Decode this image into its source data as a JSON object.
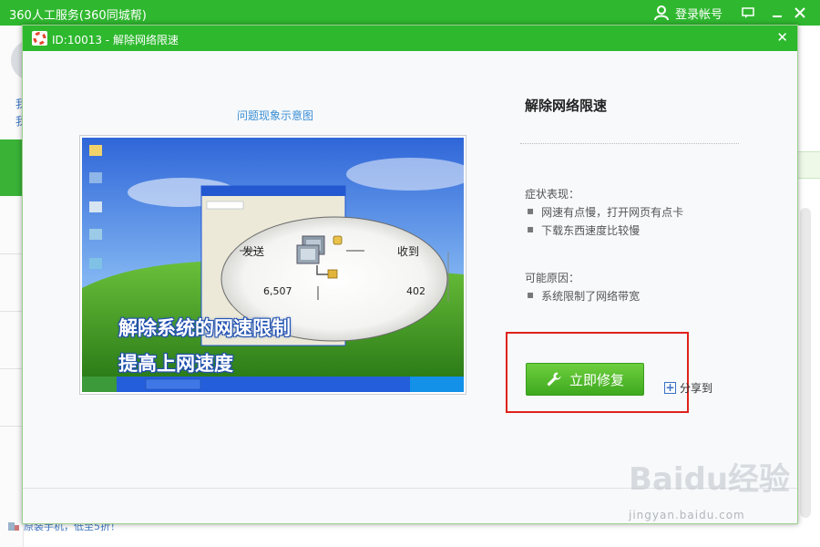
{
  "app": {
    "title": "360人工服务(360同城帮)",
    "login_label": "登录帐号",
    "side_text_1": "我",
    "side_text_2": "我",
    "bottom_link": "原装手机，低至5折！"
  },
  "dialog": {
    "title": "ID:10013 - 解除网络限速",
    "close_label": "✕"
  },
  "illustration": {
    "caption": "问题现象示意图",
    "overlay_line1": "解除系统的网速限制",
    "overlay_line2": "提高上网速度",
    "sent_label": "发送",
    "received_label": "收到",
    "sent_value": "6,507",
    "received_value": "402"
  },
  "issue": {
    "title": "解除网络限速",
    "symptoms_heading": "症状表现：",
    "symptoms": [
      "网速有点慢，打开网页有点卡",
      "下载东西速度比较慢"
    ],
    "causes_heading": "可能原因：",
    "causes": [
      "系统限制了网络带宽"
    ]
  },
  "actions": {
    "fix_label": "立即修复",
    "share_label": "分享到"
  },
  "watermark": {
    "main": "Baidu经验",
    "sub": "jingyan.baidu.com"
  },
  "colors": {
    "brand_green": "#2db82d",
    "highlight_red": "#e0221b",
    "link_blue": "#3c8fd5"
  }
}
